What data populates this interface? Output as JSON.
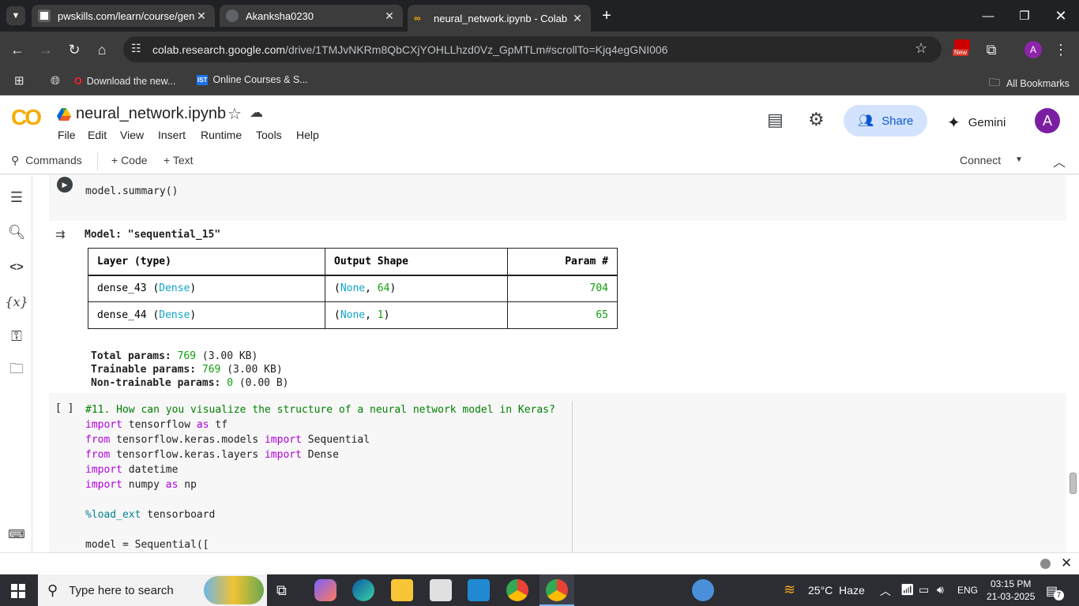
{
  "browser": {
    "tabs": [
      {
        "title": "pwskills.com/learn/course/gena",
        "active": false
      },
      {
        "title": "Akanksha0230",
        "active": false
      },
      {
        "title": "neural_network.ipynb - Colab",
        "active": true
      }
    ],
    "new_tab": "+",
    "url_host": "colab.research.google.com",
    "url_path": "/drive/1TMJvNKRm8QbCXjYOHLLhzd0Vz_GpMTLm#scrollTo=Kjq4egGNI006",
    "new_badge": "New",
    "profile_letter": "A",
    "bookmarks": {
      "item1": "Download the new...",
      "item2": "Online Courses & S...",
      "item2_badge": "IST",
      "all": "All Bookmarks"
    }
  },
  "colab": {
    "logo": "CO",
    "title": "neural_network.ipynb",
    "menu": [
      "File",
      "Edit",
      "View",
      "Insert",
      "Runtime",
      "Tools",
      "Help"
    ],
    "share": "Share",
    "gemini": "Gemini",
    "avatar": "A",
    "toolbar": {
      "commands": "Commands",
      "code": "+ Code",
      "text": "+ Text",
      "connect": "Connect"
    }
  },
  "cells": {
    "cell1_code": "model.summary()",
    "output_title": "Model: \"sequential_15\"",
    "table": {
      "headers": [
        "Layer (type)",
        "Output Shape",
        "Param #"
      ],
      "rows": [
        {
          "name": "dense_43",
          "type": "Dense",
          "shape_a": "None",
          "shape_b": "64",
          "params": "704"
        },
        {
          "name": "dense_44",
          "type": "Dense",
          "shape_a": "None",
          "shape_b": "1",
          "params": "65"
        }
      ]
    },
    "totals": {
      "total_label": "Total params:",
      "total_value": "769",
      "total_size": "(3.00 KB)",
      "trainable_label": "Trainable params:",
      "trainable_value": "769",
      "trainable_size": "(3.00 KB)",
      "non_trainable_label": "Non-trainable params:",
      "non_trainable_value": "0",
      "non_trainable_size": "(0.00 B)"
    },
    "cell2_prompt": "[ ]",
    "cell2": {
      "comment": "#11. How can you visualize the structure of a neural network model in Keras?",
      "l1_mod": "tensorflow",
      "l1_alias": "tf",
      "l2_mod": "tensorflow.keras.models",
      "l2_name": "Sequential",
      "l3_mod": "tensorflow.keras.layers",
      "l3_name": "Dense",
      "l4_mod": "datetime",
      "l5_mod": "numpy",
      "l5_alias": "np",
      "magic": "%load_ext",
      "magic_arg": "tensorboard",
      "l7_var": "model",
      "l7_call": "Sequential",
      "kw_import": "import",
      "kw_from": "from",
      "kw_as": "as"
    }
  },
  "taskbar": {
    "search_placeholder": "Type here to search",
    "weather": "25°C  Haze",
    "lang": "ENG",
    "time": "03:15 PM",
    "date": "21-03-2025",
    "notif_count": "7"
  },
  "colors": {
    "accent": "#0b57d0",
    "share_bg": "#d3e3fd",
    "colab_orange": "#f9ab00",
    "keyword": "#af00db",
    "number_green": "#11a00e",
    "cyan": "#0ca6c8"
  }
}
